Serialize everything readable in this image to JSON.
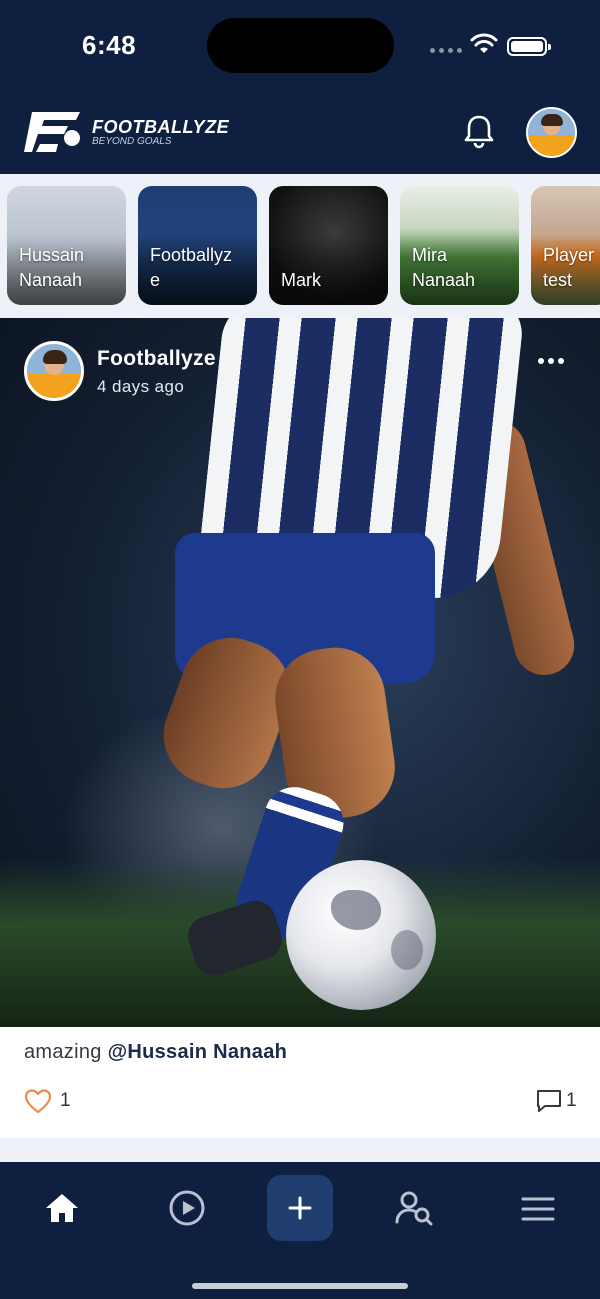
{
  "status": {
    "time": "6:48"
  },
  "brand": {
    "name": "FOOTBALLYZE",
    "tagline": "BEYOND GOALS"
  },
  "stories": [
    {
      "label": "Hussain\nNanaah"
    },
    {
      "label": "Footballyz\ne"
    },
    {
      "label": "Mark"
    },
    {
      "label": "Mira\nNanaah"
    },
    {
      "label": "Player\ntest"
    }
  ],
  "post": {
    "author": "Footballyze",
    "time_ago": "4 days ago",
    "caption_text": "amazing ",
    "caption_mention": "@Hussain Nanaah",
    "likes": "1",
    "comments": "1"
  },
  "colors": {
    "header_bg": "#0f1f40",
    "accent_like": "#f08a4b",
    "add_button": "#1f3d6e"
  },
  "icons": {
    "header": [
      "bell-icon",
      "profile-avatar"
    ],
    "nav": [
      "home-icon",
      "play-icon",
      "plus-icon",
      "user-search-icon",
      "menu-icon"
    ]
  }
}
